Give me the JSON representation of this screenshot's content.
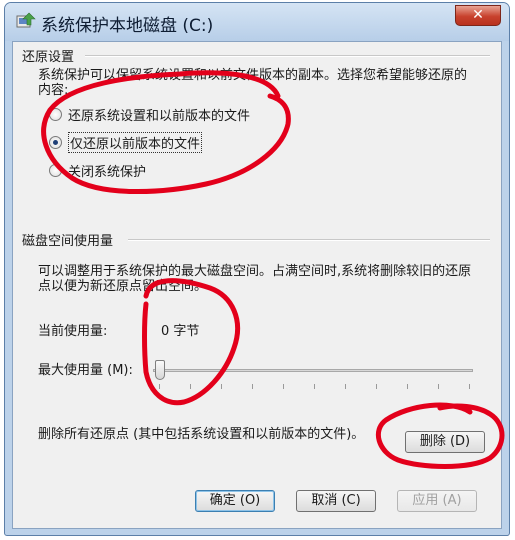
{
  "window": {
    "title": "系统保护本地磁盘 (C:)",
    "close_glyph": "✕"
  },
  "restore": {
    "title": "还原设置",
    "description": "系统保护可以保留系统设置和以前文件版本的副本。选择您希望能够还原的内容:",
    "options": [
      {
        "label": "还原系统设置和以前版本的文件",
        "checked": false
      },
      {
        "label": "仅还原以前版本的文件",
        "checked": true
      },
      {
        "label": "关闭系统保护",
        "checked": false
      }
    ]
  },
  "disk": {
    "title": "磁盘空间使用量",
    "description": "可以调整用于系统保护的最大磁盘空间。占满空间时,系统将删除较旧的还原点以便为新还原点留出空间。",
    "current_label": "当前使用量:",
    "current_value": "0 字节",
    "max_label": "最大使用量 (M):",
    "slider_value": 0
  },
  "delete": {
    "description": "删除所有还原点 (其中包括系统设置和以前版本的文件)。",
    "button_label": "删除 (D)"
  },
  "footer": {
    "ok_label": "确定 (O)",
    "cancel_label": "取消 (C)",
    "apply_label": "应用 (A)"
  },
  "colors": {
    "annotation": "#e3001b",
    "frame": "#bcd2ea",
    "client": "#f0f0f0"
  }
}
